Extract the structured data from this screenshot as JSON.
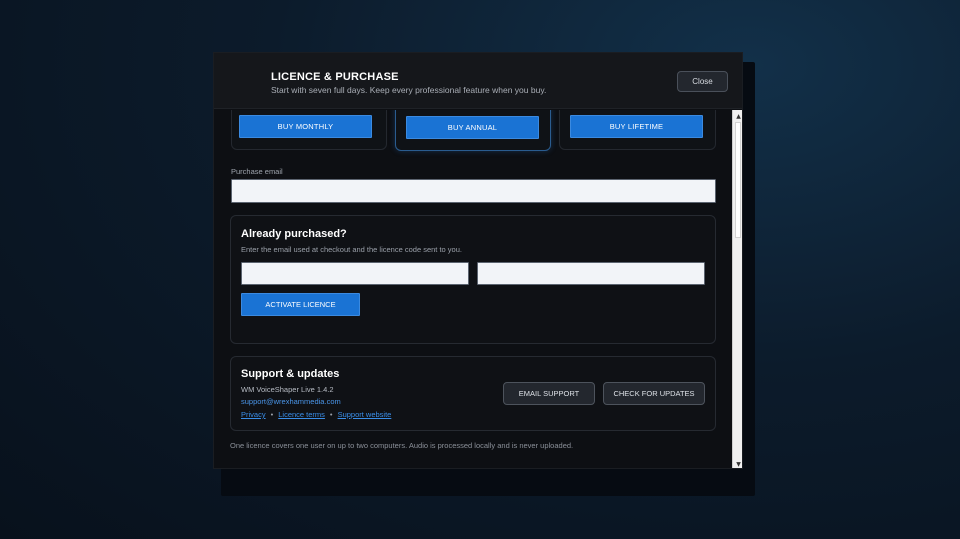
{
  "dialog": {
    "title": "LICENCE & PURCHASE",
    "subtitle": "Start with seven full days. Keep every professional feature when you buy.",
    "close_label": "Close"
  },
  "plans": {
    "monthly_label": "BUY MONTHLY",
    "annual_label": "BUY ANNUAL",
    "lifetime_label": "BUY LIFETIME",
    "featured": "annual"
  },
  "purchase_email": {
    "label": "Purchase email",
    "value": "",
    "placeholder": ""
  },
  "already_purchased": {
    "title": "Already purchased?",
    "description": "Enter the email used at checkout and the licence code sent to you.",
    "email_value": "",
    "code_value": "",
    "activate_label": "ACTIVATE LICENCE"
  },
  "support": {
    "title": "Support & updates",
    "version": "WM VoiceShaper Live 1.4.2",
    "email": "support@wrexhammedia.com",
    "links": [
      "Privacy",
      "Licence terms",
      "Support website"
    ],
    "separator": "•",
    "email_support_label": "EMAIL SUPPORT",
    "check_updates_label": "CHECK FOR UPDATES"
  },
  "footnote": "One licence covers one user on up to two computers. Audio is processed locally and is never uploaded.",
  "scrollbar": {
    "up_icon": "scroll-up-arrow-icon",
    "down_icon": "scroll-down-arrow-icon",
    "up_glyph": "▲",
    "down_glyph": "▼"
  },
  "colors": {
    "accent": "#1a73d4",
    "link": "#3a8ee8",
    "background": "#0d0f13"
  }
}
